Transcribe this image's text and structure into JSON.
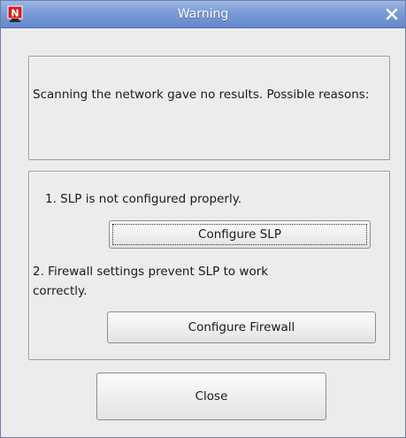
{
  "window": {
    "title": "Warning",
    "app_icon": "novell-n-icon",
    "close_icon": "close-icon"
  },
  "message": {
    "text": "Scanning the network gave no results. Possible reasons:"
  },
  "reasons": {
    "slp_text": "1. SLP is not configured properly.",
    "slp_button": "Configure SLP",
    "firewall_text_line1": "2. Firewall settings prevent SLP to work",
    "firewall_text_line2": "correctly.",
    "firewall_button": "Configure Firewall"
  },
  "footer": {
    "close_button": "Close"
  },
  "colors": {
    "titlebar": "#7a9bd6",
    "window_bg": "#ececec",
    "icon_red": "#d42020"
  }
}
